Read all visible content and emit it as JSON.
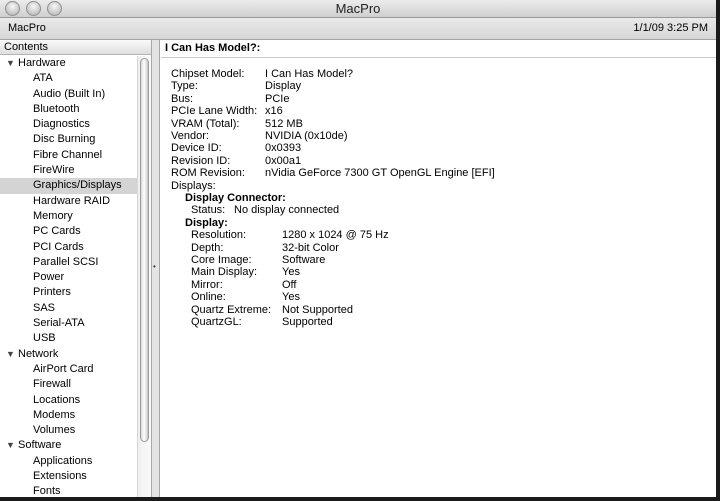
{
  "window": {
    "title": "MacPro",
    "machine": "MacPro",
    "clock": "1/1/09 3:25 PM"
  },
  "sidebar": {
    "header": "Contents",
    "items": [
      {
        "kind": "cat",
        "label": "Hardware"
      },
      {
        "kind": "leaf",
        "label": "ATA"
      },
      {
        "kind": "leaf",
        "label": "Audio (Built In)"
      },
      {
        "kind": "leaf",
        "label": "Bluetooth"
      },
      {
        "kind": "leaf",
        "label": "Diagnostics"
      },
      {
        "kind": "leaf",
        "label": "Disc Burning"
      },
      {
        "kind": "leaf",
        "label": "Fibre Channel"
      },
      {
        "kind": "leaf",
        "label": "FireWire"
      },
      {
        "kind": "leaf",
        "label": "Graphics/Displays",
        "selected": true
      },
      {
        "kind": "leaf",
        "label": "Hardware RAID"
      },
      {
        "kind": "leaf",
        "label": "Memory"
      },
      {
        "kind": "leaf",
        "label": "PC Cards"
      },
      {
        "kind": "leaf",
        "label": "PCI Cards"
      },
      {
        "kind": "leaf",
        "label": "Parallel SCSI"
      },
      {
        "kind": "leaf",
        "label": "Power"
      },
      {
        "kind": "leaf",
        "label": "Printers"
      },
      {
        "kind": "leaf",
        "label": "SAS"
      },
      {
        "kind": "leaf",
        "label": "Serial-ATA"
      },
      {
        "kind": "leaf",
        "label": "USB"
      },
      {
        "kind": "cat",
        "label": "Network"
      },
      {
        "kind": "leaf",
        "label": "AirPort Card"
      },
      {
        "kind": "leaf",
        "label": "Firewall"
      },
      {
        "kind": "leaf",
        "label": "Locations"
      },
      {
        "kind": "leaf",
        "label": "Modems"
      },
      {
        "kind": "leaf",
        "label": "Volumes"
      },
      {
        "kind": "cat",
        "label": "Software"
      },
      {
        "kind": "leaf",
        "label": "Applications"
      },
      {
        "kind": "leaf",
        "label": "Extensions"
      },
      {
        "kind": "leaf",
        "label": "Fonts"
      }
    ]
  },
  "detail": {
    "heading": "I Can Has Model?:",
    "props": [
      {
        "k": "Chipset Model:",
        "v": "I Can Has Model?"
      },
      {
        "k": "Type:",
        "v": "Display"
      },
      {
        "k": "Bus:",
        "v": "PCIe"
      },
      {
        "k": "PCIe Lane Width:",
        "v": "x16"
      },
      {
        "k": "VRAM (Total):",
        "v": "512 MB"
      },
      {
        "k": "Vendor:",
        "v": "NVIDIA (0x10de)"
      },
      {
        "k": "Device ID:",
        "v": "0x0393"
      },
      {
        "k": "Revision ID:",
        "v": "0x00a1"
      },
      {
        "k": "ROM Revision:",
        "v": "nVidia GeForce 7300 GT OpenGL Engine [EFI]"
      },
      {
        "k": "Displays:",
        "v": ""
      }
    ],
    "connector": {
      "title": "Display Connector:",
      "status_k": "Status:",
      "status_v": "No display connected"
    },
    "display": {
      "title": "Display:",
      "props": [
        {
          "k": "Resolution:",
          "v": "1280 x 1024 @ 75 Hz"
        },
        {
          "k": "Depth:",
          "v": "32-bit Color"
        },
        {
          "k": "Core Image:",
          "v": "Software"
        },
        {
          "k": "Main Display:",
          "v": "Yes"
        },
        {
          "k": "Mirror:",
          "v": "Off"
        },
        {
          "k": "Online:",
          "v": "Yes"
        },
        {
          "k": "Quartz Extreme:",
          "v": "Not Supported"
        },
        {
          "k": "QuartzGL:",
          "v": "Supported"
        }
      ]
    }
  }
}
